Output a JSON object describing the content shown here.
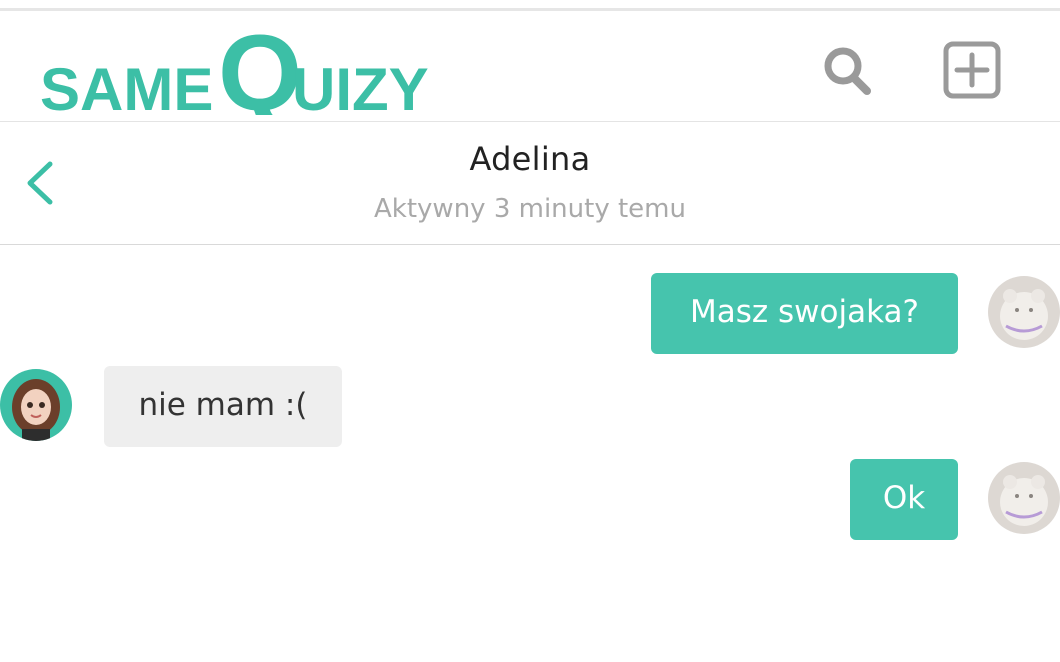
{
  "header": {
    "logo_text_1": "SAME",
    "logo_text_2": "Q",
    "logo_text_3": "UIZY",
    "brand_color": "#3cbfa6",
    "search_icon": "search-icon",
    "add_icon": "plus-square-icon"
  },
  "chat": {
    "contact_name": "Adelina",
    "contact_status": "Aktywny 3 minuty temu",
    "back_icon": "chevron-left-icon"
  },
  "messages": [
    {
      "direction": "outgoing",
      "text": "Masz swojaka?"
    },
    {
      "direction": "incoming",
      "text": "nie mam :("
    },
    {
      "direction": "outgoing",
      "text": "Ok"
    }
  ],
  "colors": {
    "outgoing_bubble": "#46c4ad",
    "incoming_bubble": "#eeeeee",
    "status_text": "#a9a9a9"
  }
}
